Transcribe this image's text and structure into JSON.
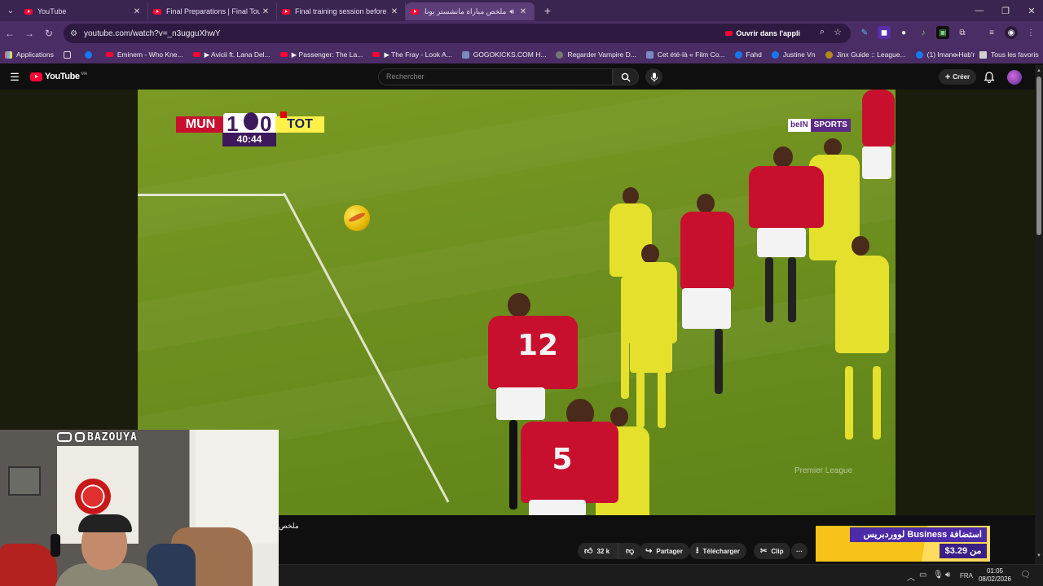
{
  "browser": {
    "tabs": [
      {
        "title": "YouTube",
        "active": false,
        "audio": false
      },
      {
        "title": "Final Preparations | Final Touch",
        "active": false,
        "audio": false
      },
      {
        "title": "Final training session before th",
        "active": false,
        "audio": false
      },
      {
        "title": "ملخص مباراة مانشستر يونايتد",
        "active": true,
        "audio": true
      }
    ],
    "new_tab": "+",
    "url": "youtube.com/watch?v=_n3ugguXhwY",
    "open_in_app": "Ouvrir dans l'appli",
    "bookmarks": [
      {
        "label": "Applications",
        "icon": "apps"
      },
      {
        "label": "",
        "icon": "grid"
      },
      {
        "label": "",
        "icon": "fb"
      },
      {
        "label": "Eminem - Who Kne...",
        "icon": "yt"
      },
      {
        "label": "▶ Avicii ft. Lana Del...",
        "icon": "yt"
      },
      {
        "label": "▶ Passenger: The La...",
        "icon": "yt"
      },
      {
        "label": "▶ The Fray - Look A...",
        "icon": "yt"
      },
      {
        "label": "GOGOKICKS.COM H...",
        "icon": "doc"
      },
      {
        "label": "Regarder Vampire D...",
        "icon": "globe"
      },
      {
        "label": "Cet été-là « Film Co...",
        "icon": "doc"
      },
      {
        "label": "Fahd",
        "icon": "fb"
      },
      {
        "label": "Justine Vn",
        "icon": "fb"
      },
      {
        "label": "Jinx Guide :: League...",
        "icon": "jinx"
      },
      {
        "label": "(1) Imane Hab'r",
        "icon": "fb"
      }
    ],
    "bookmarks_more": "»",
    "all_bookmarks": "Tous les favoris"
  },
  "youtube": {
    "logo_text": "YouTube",
    "country_code": "MA",
    "search_placeholder": "Rechercher",
    "create_label": "Créer",
    "video_title_fragment": "ملخص",
    "actions": {
      "likes": "32 k",
      "share": "Partager",
      "download": "Télécharger",
      "clip": "Clip",
      "more": "···"
    },
    "ad": {
      "headline": "استضافة Business لووردبريس",
      "price": "من 3.29$"
    }
  },
  "video_overlay": {
    "home_team": "MUN",
    "home_score": "1",
    "away_score": "0",
    "away_team": "TOT",
    "match_clock": "40:44",
    "broadcaster_a": "beIN",
    "broadcaster_b": "SPORTS",
    "league_watermark": "Premier League",
    "shirt_numbers": [
      "12",
      "5"
    ]
  },
  "webcam": {
    "handle": "BAZOUYA"
  },
  "taskbar": {
    "language": "FRA",
    "time": "01:05",
    "date": "08/02/2026"
  }
}
